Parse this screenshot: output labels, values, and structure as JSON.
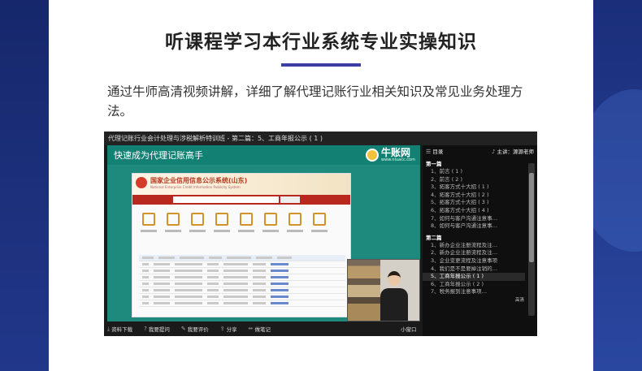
{
  "headline": "听课程学习本行业系统专业实操知识",
  "description": "通过牛师高清视频讲解，详细了解代理记账行业相关知识及常见业务处理方法。",
  "player": {
    "title": "代理记账行业会计处理与涉税解析特训班 - 第二篇：5、工商年报公示 ( 1 )",
    "video": {
      "banner_title": "快速成为代理记账高手",
      "logo_text": "牛账网",
      "logo_sub": "www.niuacc.com",
      "page_title": "国家企业信用信息公示系统(山东)",
      "page_subtitle": "National Enterprise Credit Information Publicity System"
    },
    "sidebar": {
      "catalog_label": "目录",
      "lecturer_label": "主讲：源源老师",
      "sections": [
        {
          "title": "第一篇",
          "items": [
            "1、前言 ( 1 )",
            "2、前言 ( 2 )",
            "3、拓客方式十大招 ( 1 )",
            "4、拓客方式十大招 ( 2 )",
            "5、拓客方式十大招 ( 3 )",
            "6、拓客方式十大招 ( 4 )",
            "7、如何与客户沟通注意事…",
            "8、如何与客户沟通注意事…"
          ]
        },
        {
          "title": "第二篇",
          "items": [
            "1、新办企业注册流程及注…",
            "2、新办企业注册流程及注…",
            "3、企业变更流程及注意事项",
            "4、我们是不是要掉注销的…",
            "5、工商年报公示 ( 1 )",
            "6、工商年报公示 ( 2 )",
            "7、税务报到注意事项…"
          ]
        }
      ],
      "active_label": "5、工商年报公示 ( 1 )",
      "quality_badge": "高清"
    },
    "controls": {
      "download": "资料下载",
      "ask": "我要提问",
      "review": "我要评价",
      "share": "分享",
      "notes": "做笔记",
      "small_window": "小窗口"
    }
  },
  "icons": {
    "download": "download-icon",
    "ask": "question-icon",
    "review": "comment-icon",
    "share": "share-icon",
    "notes": "pencil-icon",
    "microphone": "microphone-icon",
    "catalog": "list-icon"
  }
}
